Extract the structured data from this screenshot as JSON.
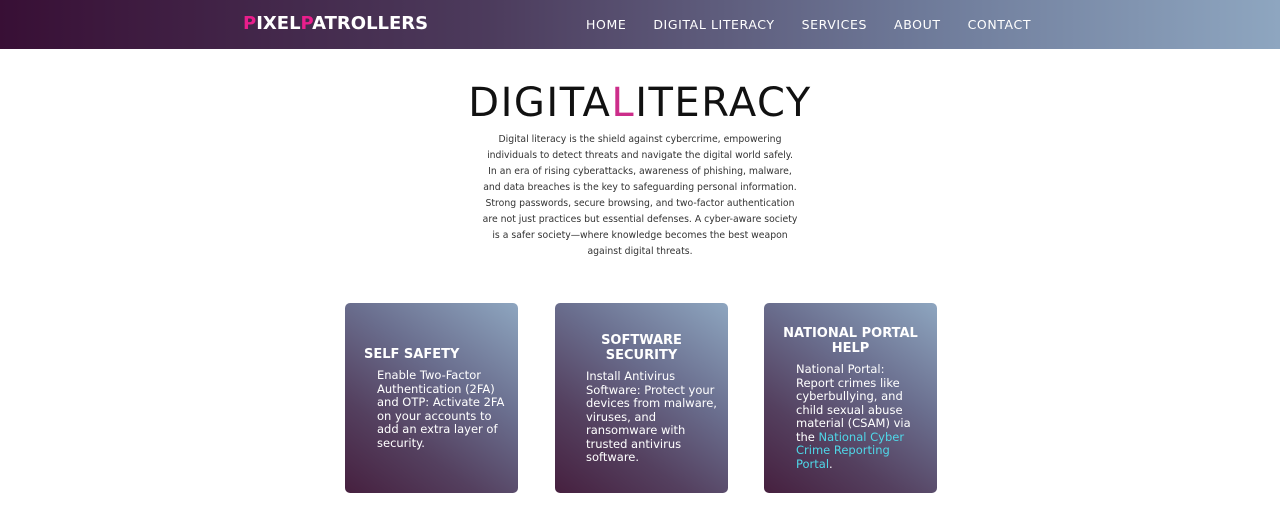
{
  "header": {
    "logo": {
      "part1": "P",
      "part2": "IXEL",
      "part3": "P",
      "part4": "ATROLLERS"
    },
    "nav": [
      "HOME",
      "DIGITAL LITERACY",
      "SERVICES",
      "ABOUT",
      "CONTACT"
    ]
  },
  "hero": {
    "title_part1": "DIGITA",
    "title_accent": "L",
    "title_part2": "ITERACY",
    "intro_lines": [
      "Digital literacy is the shield against cybercrime, empowering",
      "individuals to detect threats and navigate the digital world safely.",
      "In an era of rising cyberattacks, awareness of phishing, malware,",
      "and data breaches is the key to safeguarding personal information.",
      "Strong passwords, secure browsing, and two-factor authentication",
      "are not just practices but essential defenses. A cyber-aware society",
      "is a safer society—where knowledge becomes the best weapon",
      "against digital threats."
    ]
  },
  "cards": [
    {
      "title": "SELF SAFETY",
      "body": "Enable Two-Factor Authentication (2FA) and OTP: Activate 2FA on your accounts to add an extra layer of security."
    },
    {
      "title": "SOFTWARE SECURITY",
      "body": "Install Antivirus Software: Protect your devices from malware, viruses, and ransomware with trusted antivirus software."
    },
    {
      "title": "NATIONAL PORTAL HELP",
      "body": "National Portal: Report crimes like cyberbullying, and child sexual abuse material (CSAM) via the ",
      "link_text": "National Cyber Crime Reporting Portal",
      "suffix": "."
    }
  ],
  "colors": {
    "nav_gradient_start": "#380f35",
    "nav_gradient_end": "#8ea6c0",
    "logo_accent": "#e91e8c",
    "title_accent": "#cc2d8a",
    "link": "#4fd7e8"
  }
}
